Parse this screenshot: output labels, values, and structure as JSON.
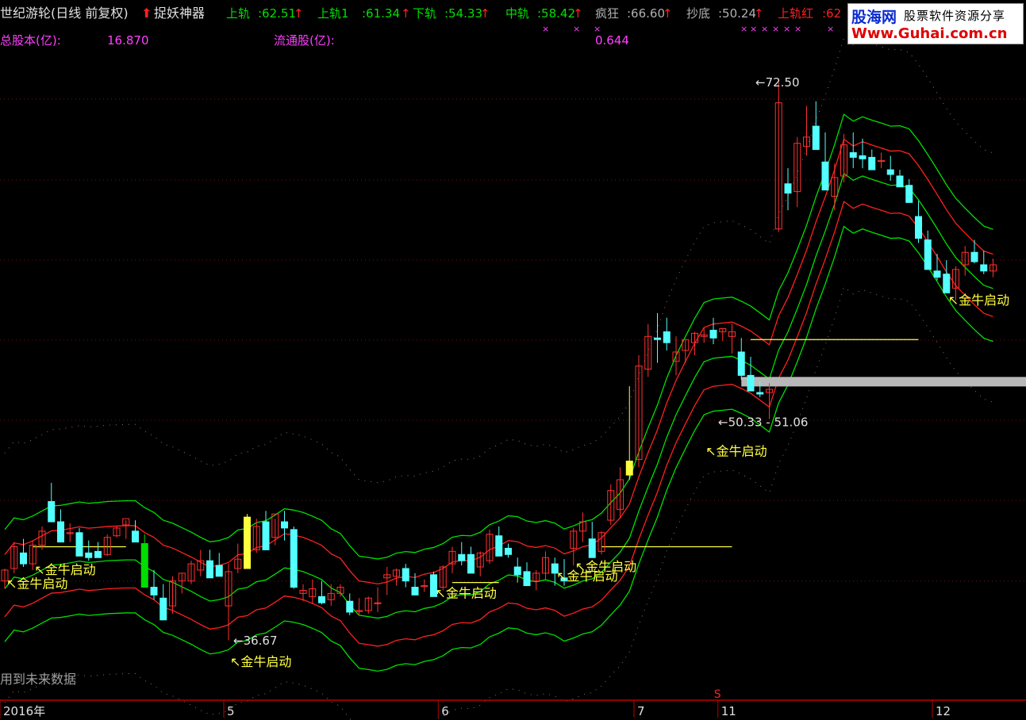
{
  "header": {
    "title": "世纪游轮(日线 前复权)",
    "indicator": "捉妖神器",
    "items": [
      {
        "label": "上轨",
        "value": "62.51",
        "color": "#00e000"
      },
      {
        "label": "上轨1",
        "value": "61.34",
        "color": "#00e000"
      },
      {
        "label": "下轨",
        "value": "54.33",
        "color": "#00e000"
      },
      {
        "label": "中轨",
        "value": "58.42",
        "color": "#00e000"
      },
      {
        "label": "疯狂",
        "value": "66.60",
        "color": "#b0b0b0"
      },
      {
        "label": "抄底",
        "value": "50.24",
        "color": "#b0b0b0"
      },
      {
        "label": "上轨红",
        "value": "62",
        "color": "#ff2020"
      }
    ],
    "total_shares_label": "总股本(亿):",
    "total_shares_value": "16.870",
    "float_shares_label": "流通股(亿):",
    "float_shares_value": "0.644"
  },
  "watermark": {
    "logo": "股海网",
    "tagline": "股票软件资源分享",
    "url": "Www.Guhai.com.cn"
  },
  "footer_note": "用到未来数据",
  "colors": {
    "up": "#ff3030",
    "down": "#54ffff",
    "upper_band": "#00e000",
    "lower_band": "#ff2020",
    "signal": "#ffff40",
    "axis": "#c00000"
  },
  "chart_data": {
    "type": "candlestick",
    "ylim": [
      33,
      75
    ],
    "x_ticks": [
      {
        "i": 0,
        "label": "2016年"
      },
      {
        "i": 24,
        "label": "5"
      },
      {
        "i": 47,
        "label": "6"
      },
      {
        "i": 68,
        "label": "7"
      },
      {
        "i": 77,
        "label": "11"
      },
      {
        "i": 100,
        "label": "12"
      }
    ],
    "marker_s": {
      "i": 77,
      "label": "S"
    },
    "annotations": [
      {
        "i": 80,
        "price": 72.5,
        "text": "72.50"
      },
      {
        "i": 24,
        "price": 36.67,
        "text": "36.67"
      },
      {
        "i": 76,
        "price": 50.7,
        "text": "50.33 - 51.06"
      }
    ],
    "signals": [
      {
        "i": 3,
        "price": 41.2,
        "text": "金牛启动"
      },
      {
        "i": 0,
        "price": 40.3,
        "text": "金牛启动"
      },
      {
        "i": 24,
        "price": 35.3,
        "text": "金牛启动"
      },
      {
        "i": 46,
        "price": 39.7,
        "text": "金牛启动"
      },
      {
        "i": 61,
        "price": 41.4,
        "text": "金牛启动"
      },
      {
        "i": 59,
        "price": 40.8,
        "text": "金牛启动"
      },
      {
        "i": 75,
        "price": 48.8,
        "text": "金牛启动"
      },
      {
        "i": 101,
        "price": 58.5,
        "text": "金牛启动"
      }
    ],
    "candles": [
      [
        40.5,
        41.3,
        40.0,
        41.2
      ],
      [
        41.3,
        43.0,
        41.0,
        42.7
      ],
      [
        42.3,
        43.2,
        41.4,
        41.6
      ],
      [
        41.6,
        43.1,
        41.2,
        42.8
      ],
      [
        42.8,
        44.0,
        42.5,
        43.7
      ],
      [
        45.6,
        46.8,
        44.8,
        44.3
      ],
      [
        44.3,
        45.1,
        43.4,
        43.0
      ],
      [
        43.6,
        44.2,
        43.0,
        43.6
      ],
      [
        43.6,
        43.9,
        42.5,
        42.1
      ],
      [
        42.3,
        43.1,
        41.8,
        42.0
      ],
      [
        42.4,
        43.0,
        42.0,
        42.0
      ],
      [
        42.2,
        43.5,
        42.1,
        43.3
      ],
      [
        43.4,
        44.0,
        43.3,
        43.9
      ],
      [
        44.1,
        44.4,
        43.2,
        44.5
      ],
      [
        43.7,
        44.4,
        43.5,
        43.0
      ],
      [
        42.9,
        43.5,
        40.5,
        40.1
      ],
      [
        40.1,
        41.2,
        39.3,
        39.6
      ],
      [
        39.4,
        40.3,
        38.8,
        38.0
      ],
      [
        38.9,
        40.8,
        38.4,
        40.5
      ],
      [
        40.5,
        41.0,
        39.7,
        41.0
      ],
      [
        40.5,
        41.8,
        40.3,
        41.6
      ],
      [
        41.2,
        42.5,
        40.8,
        41.8
      ],
      [
        41.8,
        42.5,
        40.9,
        40.7
      ],
      [
        41.5,
        42.3,
        40.8,
        40.8
      ],
      [
        38.9,
        41.6,
        36.7,
        41.1
      ],
      [
        41.3,
        42.9,
        41.0,
        41.9
      ],
      [
        44.6,
        44.8,
        41.6,
        41.3
      ],
      [
        42.5,
        44.5,
        42.3,
        44.0
      ],
      [
        44.3,
        45.0,
        42.9,
        42.5
      ],
      [
        43.3,
        44.5,
        42.8,
        44.8
      ],
      [
        44.3,
        45.0,
        43.1,
        43.9
      ],
      [
        43.8,
        44.0,
        40.0,
        40.1
      ],
      [
        39.7,
        40.3,
        39.2,
        39.9
      ],
      [
        39.5,
        40.6,
        39.0,
        40.0
      ],
      [
        39.5,
        40.5,
        39.0,
        39.1
      ],
      [
        39.3,
        40.3,
        38.9,
        39.7
      ],
      [
        39.7,
        40.3,
        39.5,
        40.1
      ],
      [
        39.2,
        39.7,
        38.3,
        38.5
      ],
      [
        38.6,
        39.4,
        38.3,
        38.6
      ],
      [
        38.6,
        39.5,
        38.4,
        39.4
      ],
      [
        39.1,
        40.1,
        38.5,
        39.1
      ],
      [
        40.7,
        41.4,
        39.6,
        40.9
      ],
      [
        40.8,
        41.3,
        40.2,
        41.2
      ],
      [
        41.3,
        41.6,
        40.1,
        40.5
      ],
      [
        40.1,
        41.0,
        39.6,
        39.6
      ],
      [
        40.2,
        40.6,
        39.8,
        40.2
      ],
      [
        40.9,
        41.1,
        39.5,
        39.5
      ],
      [
        40.1,
        41.5,
        39.9,
        41.4
      ],
      [
        41.6,
        42.7,
        41.0,
        42.4
      ],
      [
        42.2,
        43.0,
        41.5,
        41.8
      ],
      [
        42.2,
        42.7,
        41.6,
        41.0
      ],
      [
        41.4,
        42.4,
        40.8,
        42.3
      ],
      [
        41.8,
        43.8,
        41.6,
        43.5
      ],
      [
        43.4,
        44.0,
        42.6,
        42.1
      ],
      [
        42.6,
        42.9,
        42.0,
        42.2
      ],
      [
        41.4,
        42.0,
        40.4,
        40.9
      ],
      [
        41.1,
        41.7,
        40.3,
        40.2
      ],
      [
        40.5,
        41.2,
        39.9,
        41.0
      ],
      [
        41.0,
        42.4,
        40.6,
        42.0
      ],
      [
        41.6,
        42.0,
        40.2,
        41.0
      ],
      [
        40.7,
        41.9,
        40.2,
        40.5
      ],
      [
        42.6,
        43.9,
        41.5,
        43.7
      ],
      [
        43.7,
        44.9,
        43.0,
        44.3
      ],
      [
        43.2,
        44.3,
        42.5,
        42.0
      ],
      [
        42.4,
        43.7,
        42.2,
        43.6
      ],
      [
        44.4,
        46.7,
        44.1,
        46.3
      ],
      [
        45.1,
        47.8,
        44.5,
        47.0
      ],
      [
        47.3,
        53.0,
        47.0,
        48.2
      ],
      [
        48.3,
        55.0,
        47.8,
        54.3
      ],
      [
        54.1,
        57.0,
        53.6,
        56.2
      ],
      [
        56.1,
        57.7,
        54.5,
        56.0
      ],
      [
        56.5,
        57.4,
        55.3,
        55.8
      ],
      [
        54.6,
        56.2,
        53.7,
        55.2
      ],
      [
        55.3,
        56.0,
        54.5,
        56.0
      ],
      [
        55.8,
        56.5,
        55.0,
        56.4
      ],
      [
        56.2,
        56.8,
        55.8,
        56.3
      ],
      [
        56.6,
        57.4,
        55.7,
        56.1
      ],
      [
        56.5,
        56.7,
        55.9,
        56.7
      ],
      [
        56.2,
        57.0,
        55.1,
        56.5
      ],
      [
        55.2,
        56.1,
        53.4,
        53.7
      ],
      [
        53.7,
        54.9,
        52.9,
        52.7
      ],
      [
        52.6,
        53.3,
        52.3,
        52.5
      ],
      [
        52.6,
        53.2,
        50.9,
        52.8
      ],
      [
        63.1,
        72.5,
        62.9,
        71.2
      ],
      [
        66.0,
        67.0,
        64.3,
        65.4
      ],
      [
        65.5,
        69.0,
        64.5,
        68.6
      ],
      [
        68.4,
        71.0,
        67.8,
        69.0
      ],
      [
        69.7,
        71.3,
        68.3,
        68.2
      ],
      [
        67.4,
        69.3,
        66.5,
        65.6
      ],
      [
        65.2,
        67.3,
        64.3,
        66.4
      ],
      [
        66.5,
        69.2,
        66.1,
        68.5
      ],
      [
        68.0,
        69.3,
        67.0,
        67.7
      ],
      [
        67.8,
        68.9,
        67.0,
        67.6
      ],
      [
        67.7,
        68.2,
        66.9,
        66.9
      ],
      [
        67.5,
        68.0,
        67.0,
        67.5
      ],
      [
        66.9,
        67.8,
        66.2,
        66.6
      ],
      [
        66.5,
        66.9,
        65.8,
        65.8
      ],
      [
        65.9,
        66.3,
        65.3,
        64.8
      ],
      [
        63.9,
        64.9,
        62.2,
        62.5
      ],
      [
        62.4,
        63.0,
        60.6,
        60.5
      ],
      [
        60.4,
        61.5,
        59.8,
        60.0
      ],
      [
        60.2,
        61.1,
        59.0,
        59.0
      ],
      [
        59.3,
        60.7,
        58.5,
        60.5
      ],
      [
        60.8,
        62.0,
        60.1,
        61.6
      ],
      [
        61.6,
        62.4,
        60.9,
        61.0
      ],
      [
        60.8,
        61.7,
        60.2,
        60.4
      ],
      [
        60.4,
        61.2,
        60.0,
        60.8
      ]
    ]
  }
}
